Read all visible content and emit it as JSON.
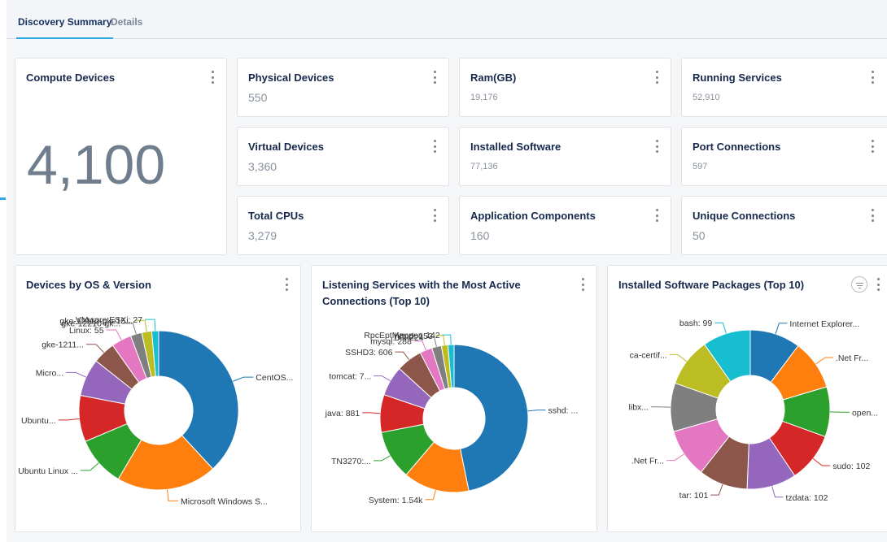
{
  "tabs": [
    {
      "label": "Discovery Summary",
      "active": true
    },
    {
      "label": "Details",
      "active": false
    }
  ],
  "compute": {
    "title": "Compute Devices",
    "value": "4,100"
  },
  "stats": [
    {
      "title": "Physical Devices",
      "value": "550"
    },
    {
      "title": "Ram(GB)",
      "value": "19,176"
    },
    {
      "title": "Running Services",
      "value": "52,910"
    },
    {
      "title": "Virtual Devices",
      "value": "3,360"
    },
    {
      "title": "Installed Software",
      "value": "77,136"
    },
    {
      "title": "Port Connections",
      "value": "597"
    },
    {
      "title": "Total CPUs",
      "value": "3,279"
    },
    {
      "title": "Application Components",
      "value": "160"
    },
    {
      "title": "Unique Connections",
      "value": "50"
    }
  ],
  "charts": {
    "os": {
      "title": "Devices by OS & Version"
    },
    "services": {
      "title_line1": "Listening Services with the Most Active",
      "title_line2": "Connections (Top 10)"
    },
    "software": {
      "title": "Installed Software Packages (Top 10)"
    }
  },
  "colors": {
    "accent": "#29a9e0",
    "palette": [
      "#1f77b4",
      "#ff7f0e",
      "#2ca02c",
      "#d62728",
      "#9467bd",
      "#8c564b",
      "#e377c2",
      "#7f7f7f",
      "#bcbd22",
      "#17becf"
    ]
  },
  "chart_data": [
    {
      "type": "pie",
      "donut": true,
      "title": "Devices by OS & Version",
      "slices": [
        {
          "label": "CentOS...",
          "value": 1500,
          "color": "#1f77b4"
        },
        {
          "label": "Microsoft Windows S...",
          "value": 800,
          "color": "#ff7f0e"
        },
        {
          "label": "Ubuntu Linux ...",
          "value": 400,
          "color": "#2ca02c"
        },
        {
          "label": "Ubuntu...",
          "value": 370,
          "color": "#d62728"
        },
        {
          "label": "Micro...",
          "value": 300,
          "color": "#9467bd"
        },
        {
          "label": "gke-1211...",
          "value": 180,
          "color": "#8c564b"
        },
        {
          "label": "Linux: 55",
          "value": 160,
          "color": "#e377c2"
        },
        {
          "label": "gke-12210-gk...",
          "value": 90,
          "color": "#7f7f7f"
        },
        {
          "label": "gke-12112-gke15...",
          "value": 80,
          "color": "#bcbd22"
        },
        {
          "label": "VMware ESXi: 27",
          "value": 55,
          "color": "#17becf"
        }
      ]
    },
    {
      "type": "pie",
      "donut": true,
      "title": "Listening Services with the Most Active Connections (Top 10)",
      "slices": [
        {
          "label": "sshd: ...",
          "value": 5000,
          "color": "#1f77b4"
        },
        {
          "label": "System: 1.54k",
          "value": 1540,
          "color": "#ff7f0e"
        },
        {
          "label": "TN3270:...",
          "value": 1150,
          "color": "#2ca02c"
        },
        {
          "label": "java: 881",
          "value": 881,
          "color": "#d62728"
        },
        {
          "label": "tomcat: 7...",
          "value": 700,
          "color": "#9467bd"
        },
        {
          "label": "SSHD3: 606",
          "value": 606,
          "color": "#8c564b"
        },
        {
          "label": "mysql: 288",
          "value": 288,
          "color": "#e377c2"
        },
        {
          "label": "DT: 224",
          "value": 224,
          "color": "#7f7f7f"
        },
        {
          "label": "httpd: 153",
          "value": 153,
          "color": "#bcbd22"
        },
        {
          "label": "RpcEptMapper: 142",
          "value": 142,
          "color": "#17becf"
        }
      ]
    },
    {
      "type": "pie",
      "donut": true,
      "title": "Installed Software Packages (Top 10)",
      "slices": [
        {
          "label": "Internet Explorer...",
          "value": 104,
          "color": "#1f77b4"
        },
        {
          "label": ".Net Fr...",
          "value": 103,
          "color": "#ff7f0e"
        },
        {
          "label": "open...",
          "value": 103,
          "color": "#2ca02c"
        },
        {
          "label": "sudo: 102",
          "value": 102,
          "color": "#d62728"
        },
        {
          "label": "tzdata: 102",
          "value": 102,
          "color": "#9467bd"
        },
        {
          "label": "tar: 101",
          "value": 101,
          "color": "#8c564b"
        },
        {
          "label": ".Net Fr...",
          "value": 101,
          "color": "#e377c2"
        },
        {
          "label": "libx...",
          "value": 100,
          "color": "#7f7f7f"
        },
        {
          "label": "ca-certif...",
          "value": 100,
          "color": "#bcbd22"
        },
        {
          "label": "bash: 99",
          "value": 99,
          "color": "#17becf"
        }
      ]
    }
  ]
}
